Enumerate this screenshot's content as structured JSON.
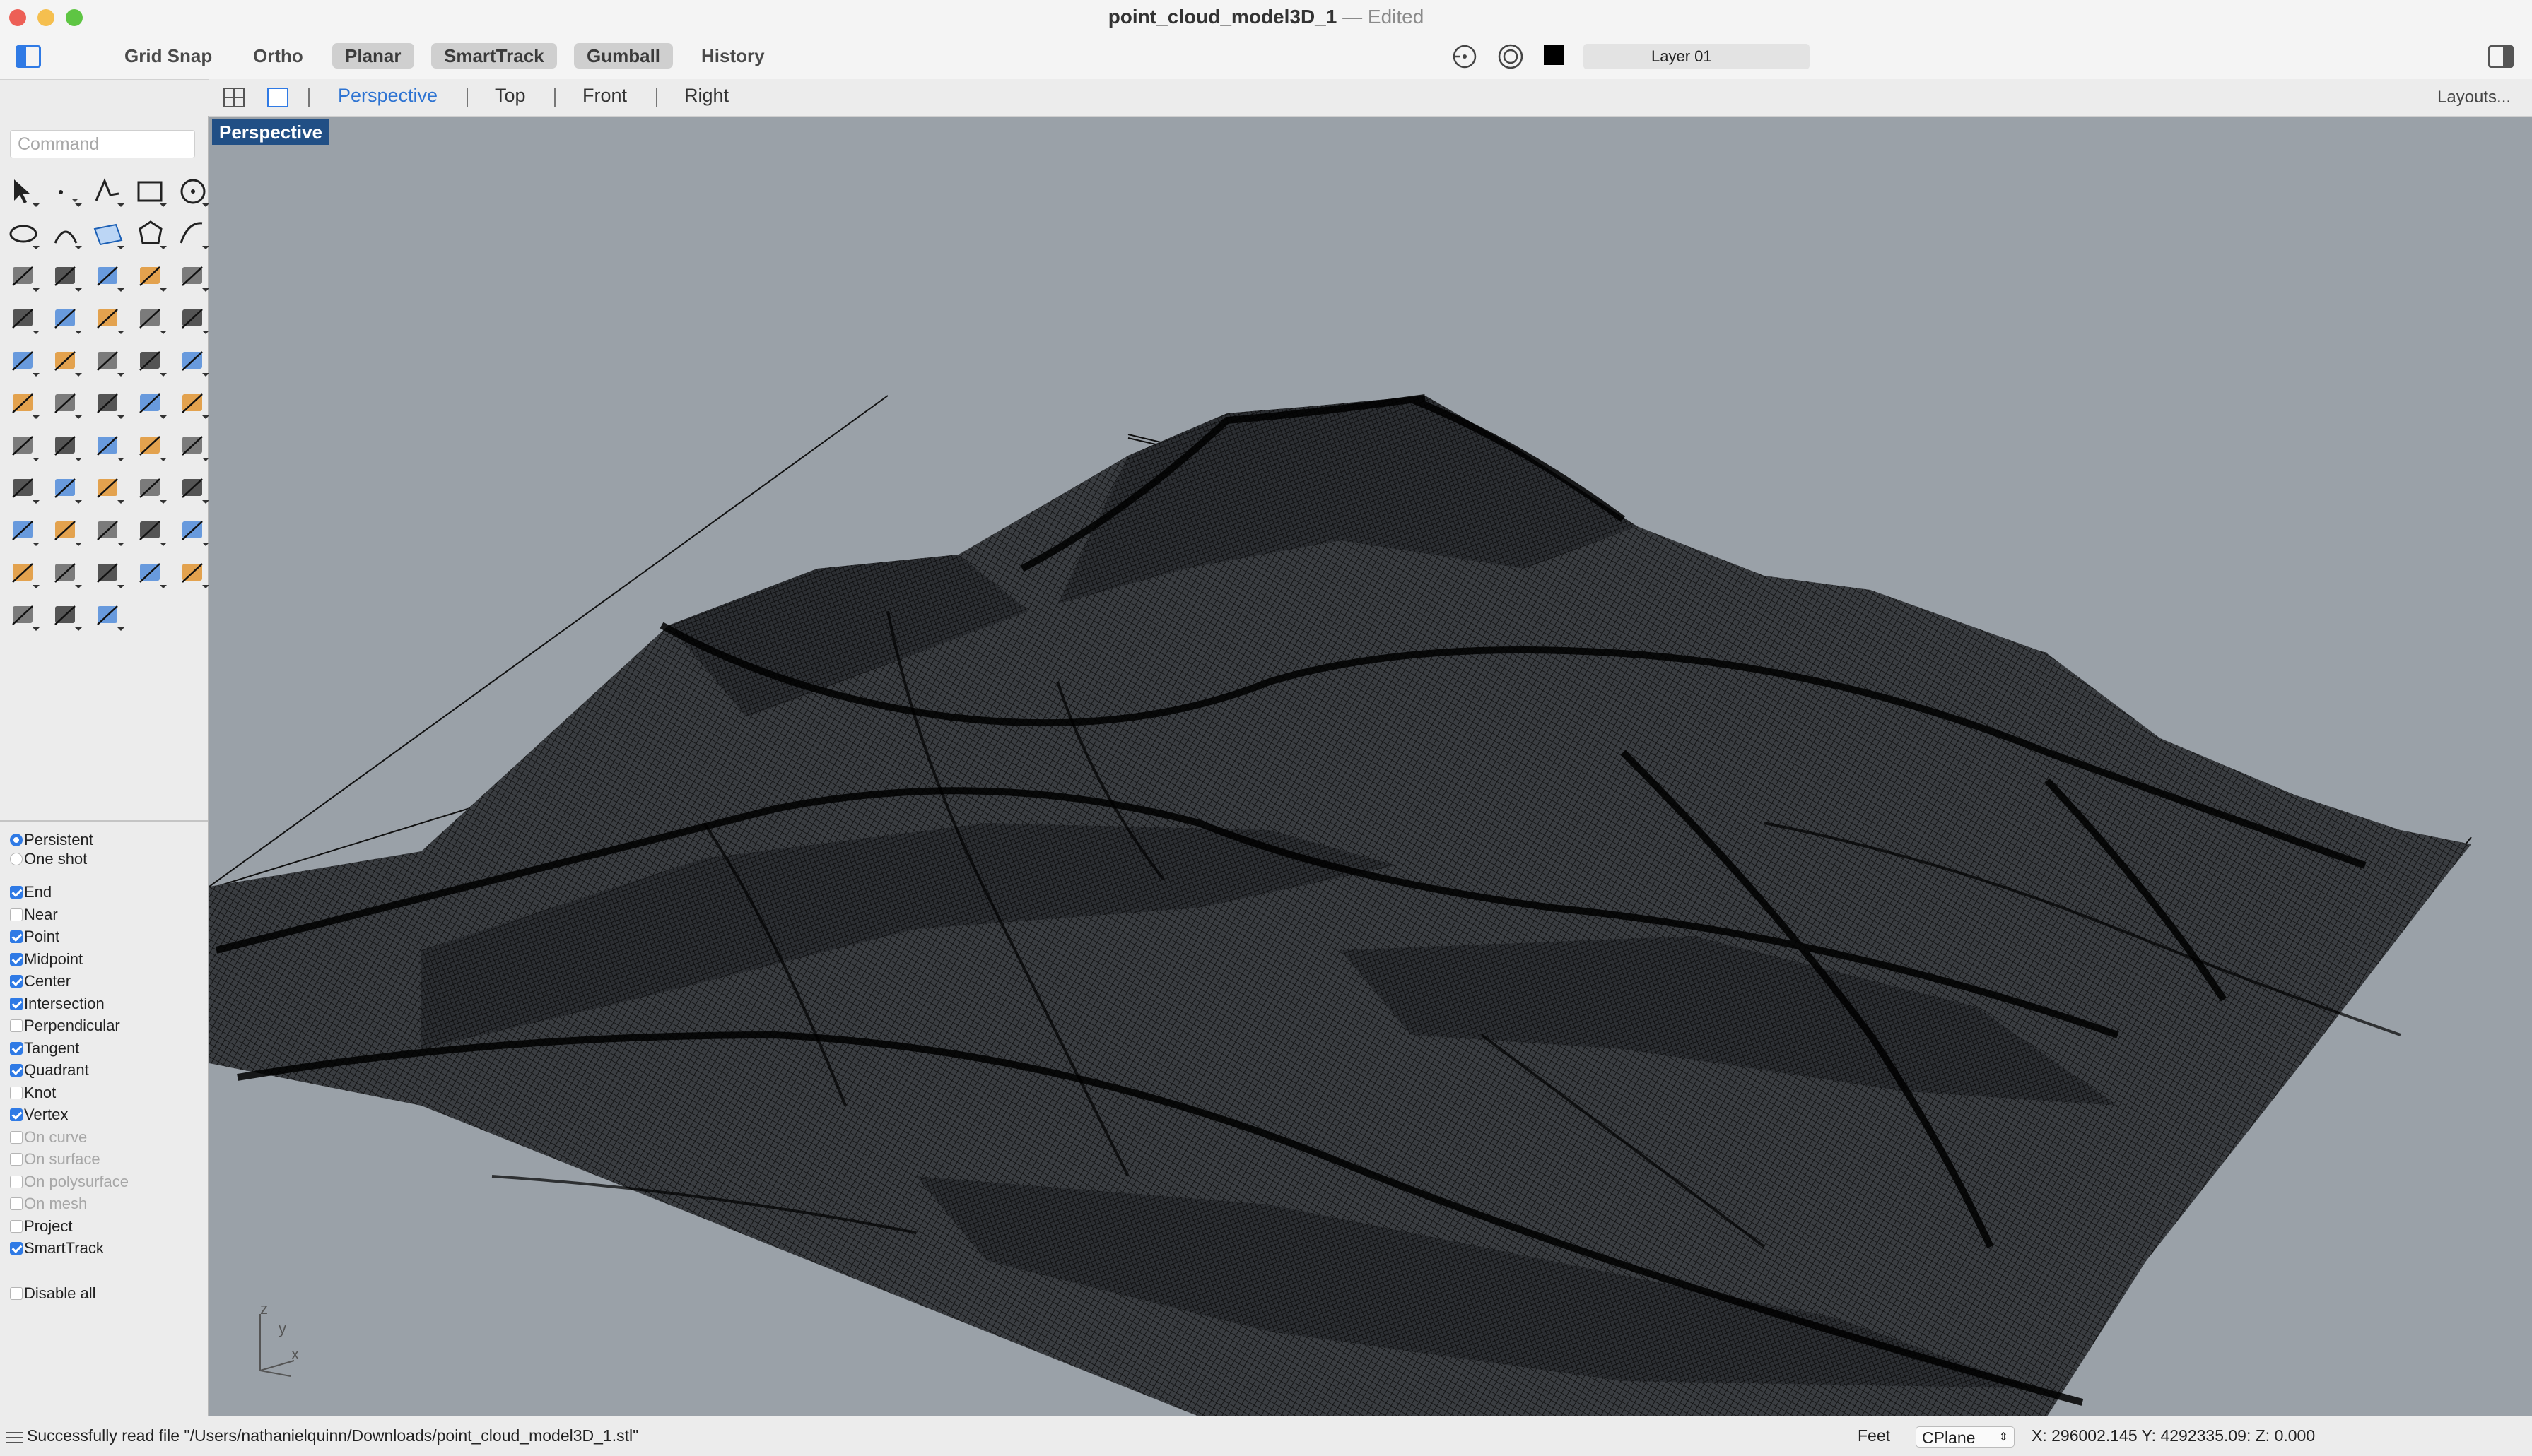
{
  "window": {
    "title": "point_cloud_model3D_1",
    "title_separator": "—",
    "status": "Edited"
  },
  "toolbar": {
    "toggles": [
      {
        "label": "Grid Snap",
        "active": false
      },
      {
        "label": "Ortho",
        "active": false
      },
      {
        "label": "Planar",
        "active": true
      },
      {
        "label": "SmartTrack",
        "active": true
      },
      {
        "label": "Gumball",
        "active": true
      },
      {
        "label": "History",
        "active": false
      }
    ],
    "layer": "Layer 01",
    "layer_color": "#000000"
  },
  "viewport_tabs": {
    "tabs": [
      "Perspective",
      "Top",
      "Front",
      "Right"
    ],
    "active": "Perspective",
    "layouts": "Layouts..."
  },
  "command": {
    "placeholder": "Command"
  },
  "osnap": {
    "modes": [
      {
        "label": "Persistent",
        "selected": true
      },
      {
        "label": "One shot",
        "selected": false
      }
    ],
    "options": [
      {
        "label": "End",
        "checked": true,
        "enabled": true
      },
      {
        "label": "Near",
        "checked": false,
        "enabled": true
      },
      {
        "label": "Point",
        "checked": true,
        "enabled": true
      },
      {
        "label": "Midpoint",
        "checked": true,
        "enabled": true
      },
      {
        "label": "Center",
        "checked": true,
        "enabled": true
      },
      {
        "label": "Intersection",
        "checked": true,
        "enabled": true
      },
      {
        "label": "Perpendicular",
        "checked": false,
        "enabled": true
      },
      {
        "label": "Tangent",
        "checked": true,
        "enabled": true
      },
      {
        "label": "Quadrant",
        "checked": true,
        "enabled": true
      },
      {
        "label": "Knot",
        "checked": false,
        "enabled": true
      },
      {
        "label": "Vertex",
        "checked": true,
        "enabled": true
      },
      {
        "label": "On curve",
        "checked": false,
        "enabled": false
      },
      {
        "label": "On surface",
        "checked": false,
        "enabled": false
      },
      {
        "label": "On polysurface",
        "checked": false,
        "enabled": false
      },
      {
        "label": "On mesh",
        "checked": false,
        "enabled": false
      },
      {
        "label": "Project",
        "checked": false,
        "enabled": true
      },
      {
        "label": "SmartTrack",
        "checked": true,
        "enabled": true
      }
    ],
    "disable_all": "Disable all"
  },
  "viewport": {
    "label": "Perspective",
    "axes": {
      "z": "z",
      "y": "y",
      "x": "x"
    }
  },
  "statusbar": {
    "message": "Successfully read file \"/Users/nathanielquinn/Downloads/point_cloud_model3D_1.stl\"",
    "units": "Feet",
    "cplane": "CPlane",
    "coords": "X: 296002.145  Y: 4292335.09: Z: 0.000"
  },
  "icons": [
    "select-arrow-icon",
    "point-icon",
    "polyline-icon",
    "rectangle-icon",
    "circle-icon",
    "ellipse-icon",
    "arc-icon",
    "plane-icon",
    "polygon-icon",
    "curve-icon",
    "surface-icon",
    "extrude-icon",
    "box-icon",
    "sphere-icon",
    "cylinder-icon",
    "loft-icon",
    "puzzle-icon",
    "sweep-icon",
    "fillet-icon",
    "trim-icon",
    "boolean-icon",
    "group-icon",
    "blend-icon",
    "offset-icon",
    "text-icon",
    "move-icon",
    "array-icon",
    "scale-icon",
    "block-icon",
    "dimension-icon",
    "grid-array-icon",
    "align-icon",
    "clipboard-icon",
    "check-icon",
    "solid-edit-icon",
    "paint-icon",
    "zoom-icon",
    "zoom-window-icon",
    "zoom-extents-icon",
    "zoom-selected-icon",
    "rotate-view-icon",
    "car-icon",
    "mesh-icon",
    "shapes-icon",
    "light-icon",
    "lock-icon",
    "material-icon",
    "color-wheel-icon",
    "shade-icon",
    "render-icon",
    "render-sphere-icon",
    "cone-icon",
    "transform-icon"
  ]
}
